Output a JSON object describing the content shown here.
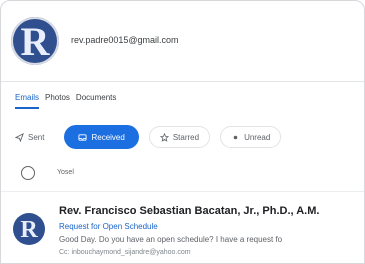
{
  "account": {
    "avatar_letter": "R",
    "email": "rev.padre0015@gmail.com"
  },
  "tabs": [
    {
      "label": "Emails",
      "active": true
    },
    {
      "label": "Photos",
      "active": false
    },
    {
      "label": "Documents",
      "active": false
    }
  ],
  "filters": [
    {
      "label": "Sent",
      "icon": "send-icon",
      "active": false
    },
    {
      "label": "Received",
      "icon": "inbox-icon",
      "active": true
    },
    {
      "label": "Starred",
      "icon": "star-icon",
      "active": false
    },
    {
      "label": "Unread",
      "icon": "dot-icon",
      "active": false
    }
  ],
  "select_all": {
    "label": "Yosel"
  },
  "message": {
    "avatar_letter": "R",
    "sender": "Rev. Francisco Sebastian Bacatan, Jr., Ph.D., A.M.",
    "subject": "Request for Open Schedule",
    "snippet": "Good Day. Do you have an open schedule? I have a request fo",
    "cc": "Cc: inbouchaymond_sijandre@yahoo.com"
  },
  "colors": {
    "accent": "#1c6fe0",
    "avatar_bg": "#2f4f8f"
  }
}
